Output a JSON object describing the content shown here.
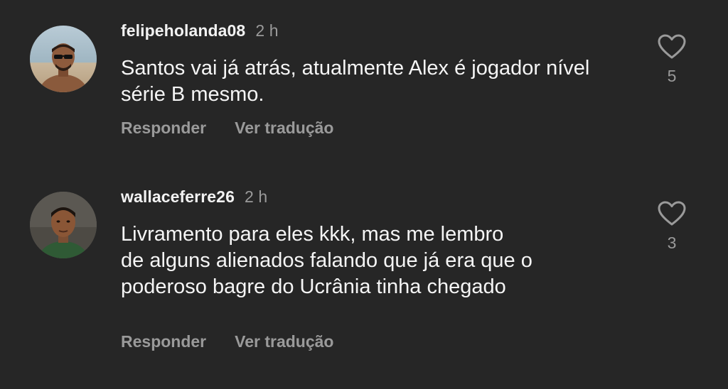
{
  "comments": [
    {
      "username": "felipeholanda08",
      "time": "2 h",
      "text": "Santos vai já atrás, atualmente Alex é jogador nível\nsérie B mesmo.",
      "reply_label": "Responder",
      "translate_label": "Ver tradução",
      "likes": "5",
      "like_icon": "heart-outline-icon"
    },
    {
      "username": "wallaceferre26",
      "time": "2 h",
      "text": "Livramento para eles kkk, mas me lembro\nde alguns alienados falando que já era que o\npoderoso bagre do Ucrânia tinha chegado",
      "reply_label": "Responder",
      "translate_label": "Ver tradução",
      "likes": "3",
      "like_icon": "heart-outline-icon"
    }
  ],
  "colors": {
    "background": "#262626",
    "primary_text": "#f5f5f5",
    "secondary_text": "#9a9a9a"
  }
}
